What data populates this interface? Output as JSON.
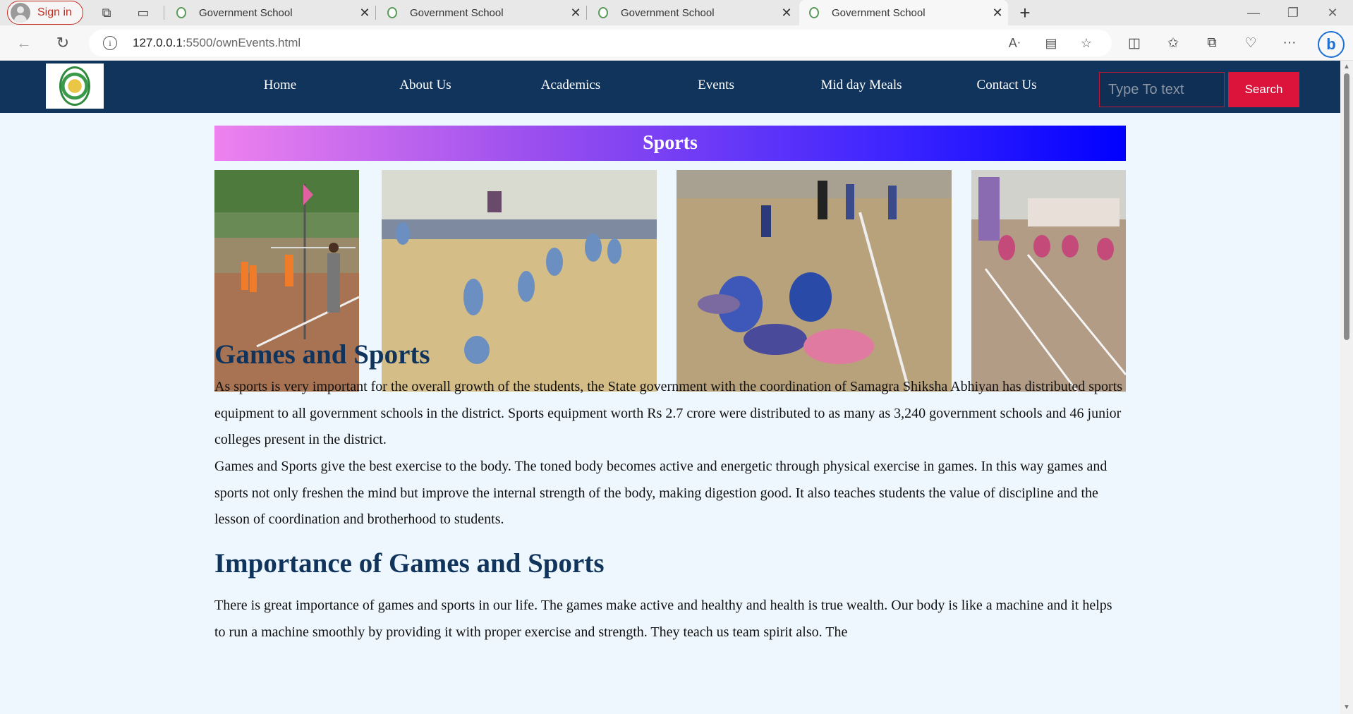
{
  "browser": {
    "signin_label": "Sign in",
    "tabs": [
      {
        "title": "Government School"
      },
      {
        "title": "Government School"
      },
      {
        "title": "Government School"
      },
      {
        "title": "Government School"
      }
    ],
    "url_host": "127.0.0.1",
    "url_rest": ":5500/ownEvents.html"
  },
  "site": {
    "nav": [
      "Home",
      "About Us",
      "Academics",
      "Events",
      "Mid day Meals",
      "Contact Us"
    ],
    "search_placeholder": "Type To text",
    "search_label": "Search"
  },
  "page": {
    "banner": "Sports",
    "heading1": "Games and Sports",
    "para1": "As sports is very important for the overall growth of the students, the State government with the coordination of Samagra Shiksha Abhiyan has distributed sports equipment to all government schools in the district. Sports equipment worth Rs 2.7 crore were distributed to as many as 3,240 government schools and 46 junior colleges present in the district.",
    "para2": "Games and Sports give the best exercise to the body. The toned body becomes active and energetic through physical exercise in games. In this way games and sports not only freshen the mind but improve the internal strength of the body, making digestion good. It also teaches students the value of discipline and the lesson of coordination and brotherhood to students.",
    "heading2": "Importance of Games and Sports",
    "para3": "There is great importance of games and sports in our life. The games make active and healthy and health is true wealth. Our body is like a machine and it helps to run a machine smoothly by providing it with proper exercise and strength. They teach us team spirit also. The"
  },
  "colors": {
    "nav_bg": "#10345c",
    "heading": "#10345c",
    "search_button": "#dc143c",
    "page_bg": "#eef7fd"
  }
}
